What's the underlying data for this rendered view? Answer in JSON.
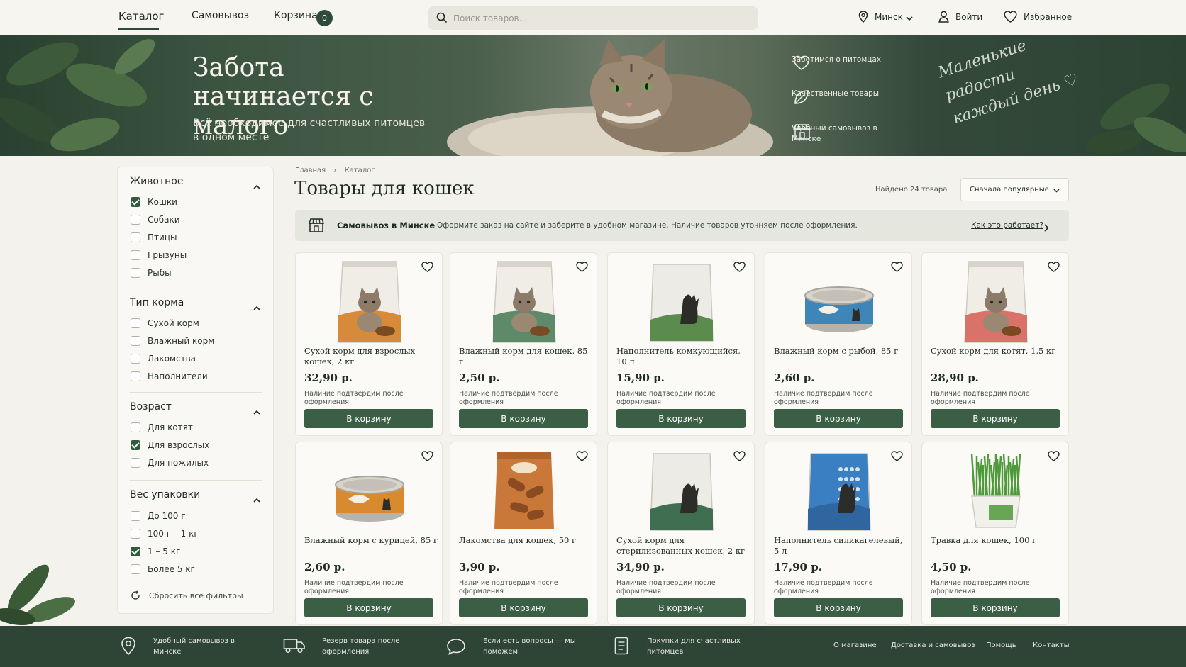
{
  "nav": {
    "tabs": [
      {
        "label": "Каталог"
      },
      {
        "label": "Самовывоз"
      },
      {
        "label": "Корзина"
      }
    ],
    "cart_count": "0",
    "search_placeholder": "Поиск товаров...",
    "city": "Минск",
    "login": "Войти",
    "favorites": "Избранное"
  },
  "banner": {
    "title": "Забота начинается с малого",
    "subtitle": "Всё необходимое для счастливых питомцев в одном месте",
    "features": [
      {
        "icon": "heart-icon",
        "text": "Заботимся о питомцах"
      },
      {
        "icon": "leaf-icon",
        "text": "Качественные товары"
      },
      {
        "icon": "store-icon",
        "text": "Удобный самовывоз в Минске"
      }
    ],
    "script_text": "Маленькие радости каждый день ♡"
  },
  "filters": [
    {
      "title": "Животное",
      "options": [
        {
          "label": "Кошки",
          "checked": true
        },
        {
          "label": "Собаки",
          "checked": false
        },
        {
          "label": "Птицы",
          "checked": false
        },
        {
          "label": "Грызуны",
          "checked": false
        },
        {
          "label": "Рыбы",
          "checked": false
        }
      ]
    },
    {
      "title": "Тип корма",
      "options": [
        {
          "label": "Сухой корм",
          "checked": false
        },
        {
          "label": "Влажный корм",
          "checked": false
        },
        {
          "label": "Лакомства",
          "checked": false
        },
        {
          "label": "Наполнители",
          "checked": false
        }
      ]
    },
    {
      "title": "Возраст",
      "options": [
        {
          "label": "Для котят",
          "checked": false
        },
        {
          "label": "Для взрослых",
          "checked": true
        },
        {
          "label": "Для пожилых",
          "checked": false
        }
      ]
    },
    {
      "title": "Вес упаковки",
      "options": [
        {
          "label": "До 100 г",
          "checked": false
        },
        {
          "label": "100 г – 1 кг",
          "checked": false
        },
        {
          "label": "1 – 5 кг",
          "checked": true
        },
        {
          "label": "Более 5 кг",
          "checked": false
        }
      ]
    }
  ],
  "reset_label": "Сбросить все фильтры",
  "breadcrumb": {
    "home": "Главная",
    "sep": "›",
    "current": "Каталог"
  },
  "page_title": "Товары для кошек",
  "found_text": "Найдено 24 товара",
  "sort_value": "Сначала популярные",
  "pickup": {
    "title": "Самовывоз в Минске",
    "text": "Оформите заказ на сайте и заберите в удобном магазине. Наличие товаров уточняем после оформления.",
    "link": "Как это работает?"
  },
  "availability_text": "Наличие подтвердим после оформления",
  "add_to_cart_label": "В корзину",
  "products": [
    {
      "name": "Сухой корм для взрослых кошек, 2 кг",
      "price": "32,90 р.",
      "image": "dry-food-bag-orange",
      "color": "#d68a3a"
    },
    {
      "name": "Влажный корм для кошек, 85 г",
      "price": "2,50 р.",
      "image": "wet-food-pouch",
      "color": "#5e8a6a"
    },
    {
      "name": "Наполнитель комкующийся, 10 л",
      "price": "15,90 р.",
      "image": "litter-bag-green",
      "color": "#5b8c4e"
    },
    {
      "name": "Влажный корм с рыбой, 85 г",
      "price": "2,60 р.",
      "image": "fish-can-blue",
      "color": "#3f86b8"
    },
    {
      "name": "Сухой корм для котят, 1,5 кг",
      "price": "28,90 р.",
      "image": "kitten-food-bag-pink",
      "color": "#d9736a"
    },
    {
      "name": "Влажный корм с курицей, 85 г",
      "price": "2,60 р.",
      "image": "chicken-can-orange",
      "color": "#d98a2e"
    },
    {
      "name": "Лакомства для кошек, 50 г",
      "price": "3,90 р.",
      "image": "treats-bag",
      "color": "#c9783a"
    },
    {
      "name": "Сухой корм для стерилизованных кошек, 2 кг",
      "price": "34,90 р.",
      "image": "sterilized-food-bag",
      "color": "#3f6e50"
    },
    {
      "name": "Наполнитель силикагелевый, 5 л",
      "price": "17,90 р.",
      "image": "silica-litter-bag",
      "color": "#3a7fc2"
    },
    {
      "name": "Травка для кошек, 100 г",
      "price": "4,50 р.",
      "image": "cat-grass-pot",
      "color": "#4f9a3a"
    }
  ],
  "footer": {
    "items": [
      {
        "icon": "location-pin-icon",
        "text": "Удобный самовывоз в Минске"
      },
      {
        "icon": "truck-icon",
        "text": "Резерв товара после оформления"
      },
      {
        "icon": "chat-bubble-icon",
        "text": "Если есть вопросы — мы поможем"
      },
      {
        "icon": "receipt-icon",
        "text": "Покупки для счастливых питомцев"
      }
    ],
    "links": [
      "О магазине",
      "Доставка и самовывоз",
      "Помощь",
      "Контакты"
    ]
  },
  "colors": {
    "accent": "#3b5f45",
    "dark_green": "#2e4434",
    "background": "#f4f2ec"
  }
}
